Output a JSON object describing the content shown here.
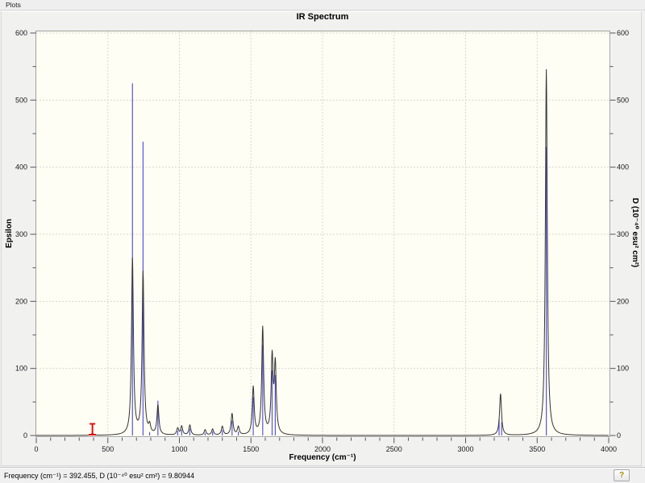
{
  "menu_bar": {
    "items": [
      {
        "label": "Plots"
      }
    ]
  },
  "chart": {
    "plot_bg": "#fffef4",
    "grid_color": "#d8d8d0",
    "frame_color": "#a0a09c",
    "highlight_color": "#fdfdfd",
    "tick_color": "#55555a",
    "label_color": "#1a1a1a",
    "curve_color": "#333333",
    "stick_color": "#5555dd",
    "cursor_color": "#e01010"
  },
  "chart_data": {
    "type": "line",
    "title": "IR Spectrum",
    "xlabel": "Frequency (cm⁻¹)",
    "ylabel_left": "Epsilon",
    "ylabel_right": "D (10⁻⁴⁰ esu² cm²)",
    "xlim": [
      0,
      4000
    ],
    "ylim": [
      0,
      600
    ],
    "x_major_tick": 500,
    "x_minor_tick": 100,
    "y_major_tick": 100,
    "y_minor_tick": 50,
    "grid": true,
    "series": [
      {
        "name": "Epsilon",
        "style": "lorentzian-curve",
        "hwhm_cm1": 8,
        "peaks": [
          [
            392.455,
            3
          ],
          [
            672,
            262
          ],
          [
            746,
            242
          ],
          [
            792,
            12
          ],
          [
            850,
            44
          ],
          [
            988,
            10
          ],
          [
            1016,
            13
          ],
          [
            1073,
            15
          ],
          [
            1180,
            8
          ],
          [
            1232,
            9
          ],
          [
            1300,
            13
          ],
          [
            1368,
            32
          ],
          [
            1412,
            12
          ],
          [
            1516,
            71
          ],
          [
            1582,
            160
          ],
          [
            1648,
            113
          ],
          [
            1670,
            102
          ],
          [
            3244,
            62
          ],
          [
            3564,
            546
          ]
        ]
      },
      {
        "name": "D",
        "style": "vertical-sticks",
        "sticks": [
          [
            392.455,
            9.80944
          ],
          [
            672,
            525
          ],
          [
            746,
            438
          ],
          [
            792,
            5
          ],
          [
            850,
            52
          ],
          [
            988,
            7
          ],
          [
            1016,
            9
          ],
          [
            1073,
            10
          ],
          [
            1180,
            4
          ],
          [
            1232,
            6
          ],
          [
            1300,
            8
          ],
          [
            1368,
            22
          ],
          [
            1412,
            6
          ],
          [
            1516,
            57
          ],
          [
            1582,
            135
          ],
          [
            1648,
            97
          ],
          [
            1670,
            90
          ],
          [
            3234,
            25
          ],
          [
            3252,
            20
          ],
          [
            3564,
            430
          ]
        ]
      }
    ],
    "cursor": {
      "x": 392.455,
      "d": 9.80944
    }
  },
  "status_bar": {
    "text": "Frequency (cm⁻¹) = 392.455, D (10⁻⁴⁰ esu² cm²) = 9.80944",
    "help_label": "?"
  }
}
